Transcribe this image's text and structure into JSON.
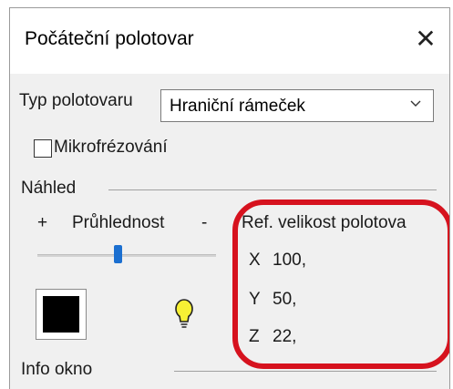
{
  "dialog": {
    "title": "Počáteční polotovar",
    "close_icon": "close-icon"
  },
  "stock_type": {
    "label": "Typ polotovaru",
    "selected": "Hraniční rámeček"
  },
  "microfrezovani": {
    "label": "Mikrofrézování",
    "checked": false
  },
  "preview": {
    "section_label": "Náhled",
    "transparency": {
      "plus": "+",
      "label": "Průhlednost",
      "minus": "-",
      "level": 0.45
    },
    "color_swatch": "#000000",
    "bulb_color": "#f7f034"
  },
  "ref_size": {
    "label": "Ref. velikost polotova",
    "x_label": "X",
    "x_value": "100,",
    "y_label": "Y",
    "y_value": "50,",
    "z_label": "Z",
    "z_value": "22,"
  },
  "info": {
    "section_label": "Info okno"
  },
  "annotation_color": "#d6121e"
}
